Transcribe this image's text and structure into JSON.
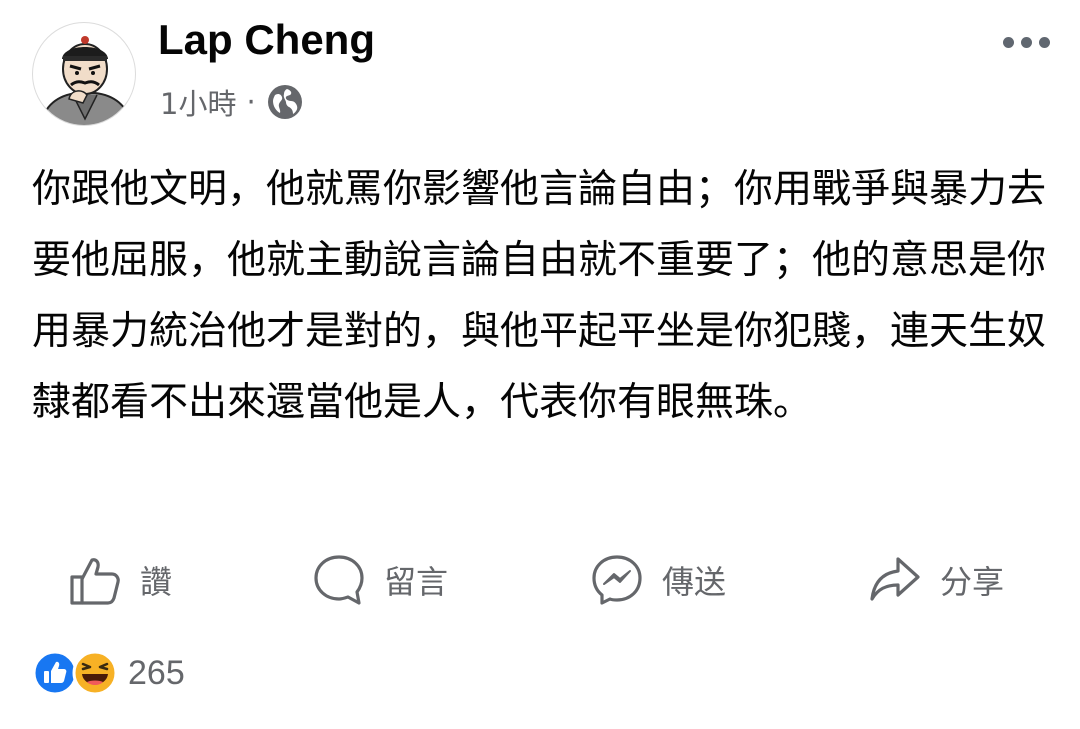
{
  "post": {
    "author": "Lap Cheng",
    "time": "1小時",
    "separator": "·",
    "text": "你跟他文明，他就罵你影響他言論自由；你用戰爭與暴力去要他屈服，他就主動說言論自由就不重要了；他的意思是你用暴力統治他才是對的，與他平起平坐是你犯賤，連天生奴隸都看不出來還當他是人，代表你有眼無珠。"
  },
  "actions": {
    "like": "讚",
    "comment": "留言",
    "send": "傳送",
    "share": "分享"
  },
  "reactions": {
    "icons": [
      "like-reaction-icon",
      "haha-reaction-icon"
    ],
    "count": "265"
  },
  "colors": {
    "text": "#050505",
    "secondary": "#65676b",
    "like_blue": "#1877f2",
    "haha_yellow": "#f7b125"
  }
}
